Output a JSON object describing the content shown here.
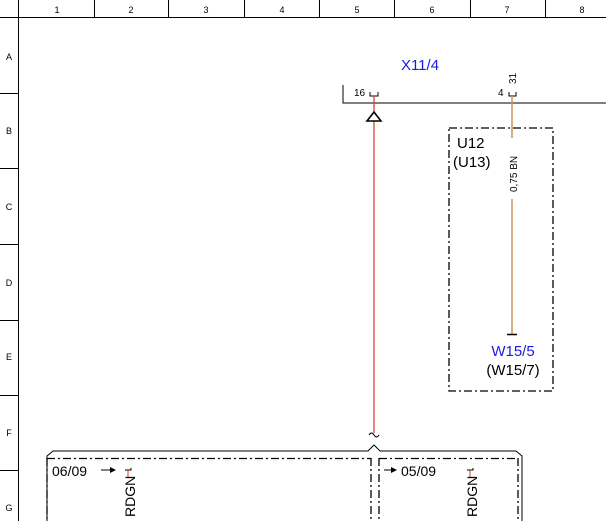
{
  "grid": {
    "columns": [
      "1",
      "2",
      "3",
      "4",
      "5",
      "6",
      "7",
      "8"
    ],
    "rows": [
      "A",
      "B",
      "C",
      "D",
      "E",
      "F",
      "G"
    ]
  },
  "connector": {
    "name": "X11/4",
    "pin_left": "16",
    "pin_right": "4",
    "pin_right_small": "31"
  },
  "component": {
    "name": "U12",
    "alt_name": "(U13)"
  },
  "wire": {
    "label": "0,75 BN",
    "color_brown": "#c8965a",
    "color_red": "#d23a2a"
  },
  "splice": {
    "name": "W15/5",
    "alt_name": "(W15/7)"
  },
  "bottom": {
    "left_ref": "06/09",
    "left_wire": "RDGN",
    "right_ref": "05/09",
    "right_wire": "RDGN"
  },
  "colors": {
    "connector_text": "#1a1ae6",
    "dashed_box": "#000000"
  }
}
